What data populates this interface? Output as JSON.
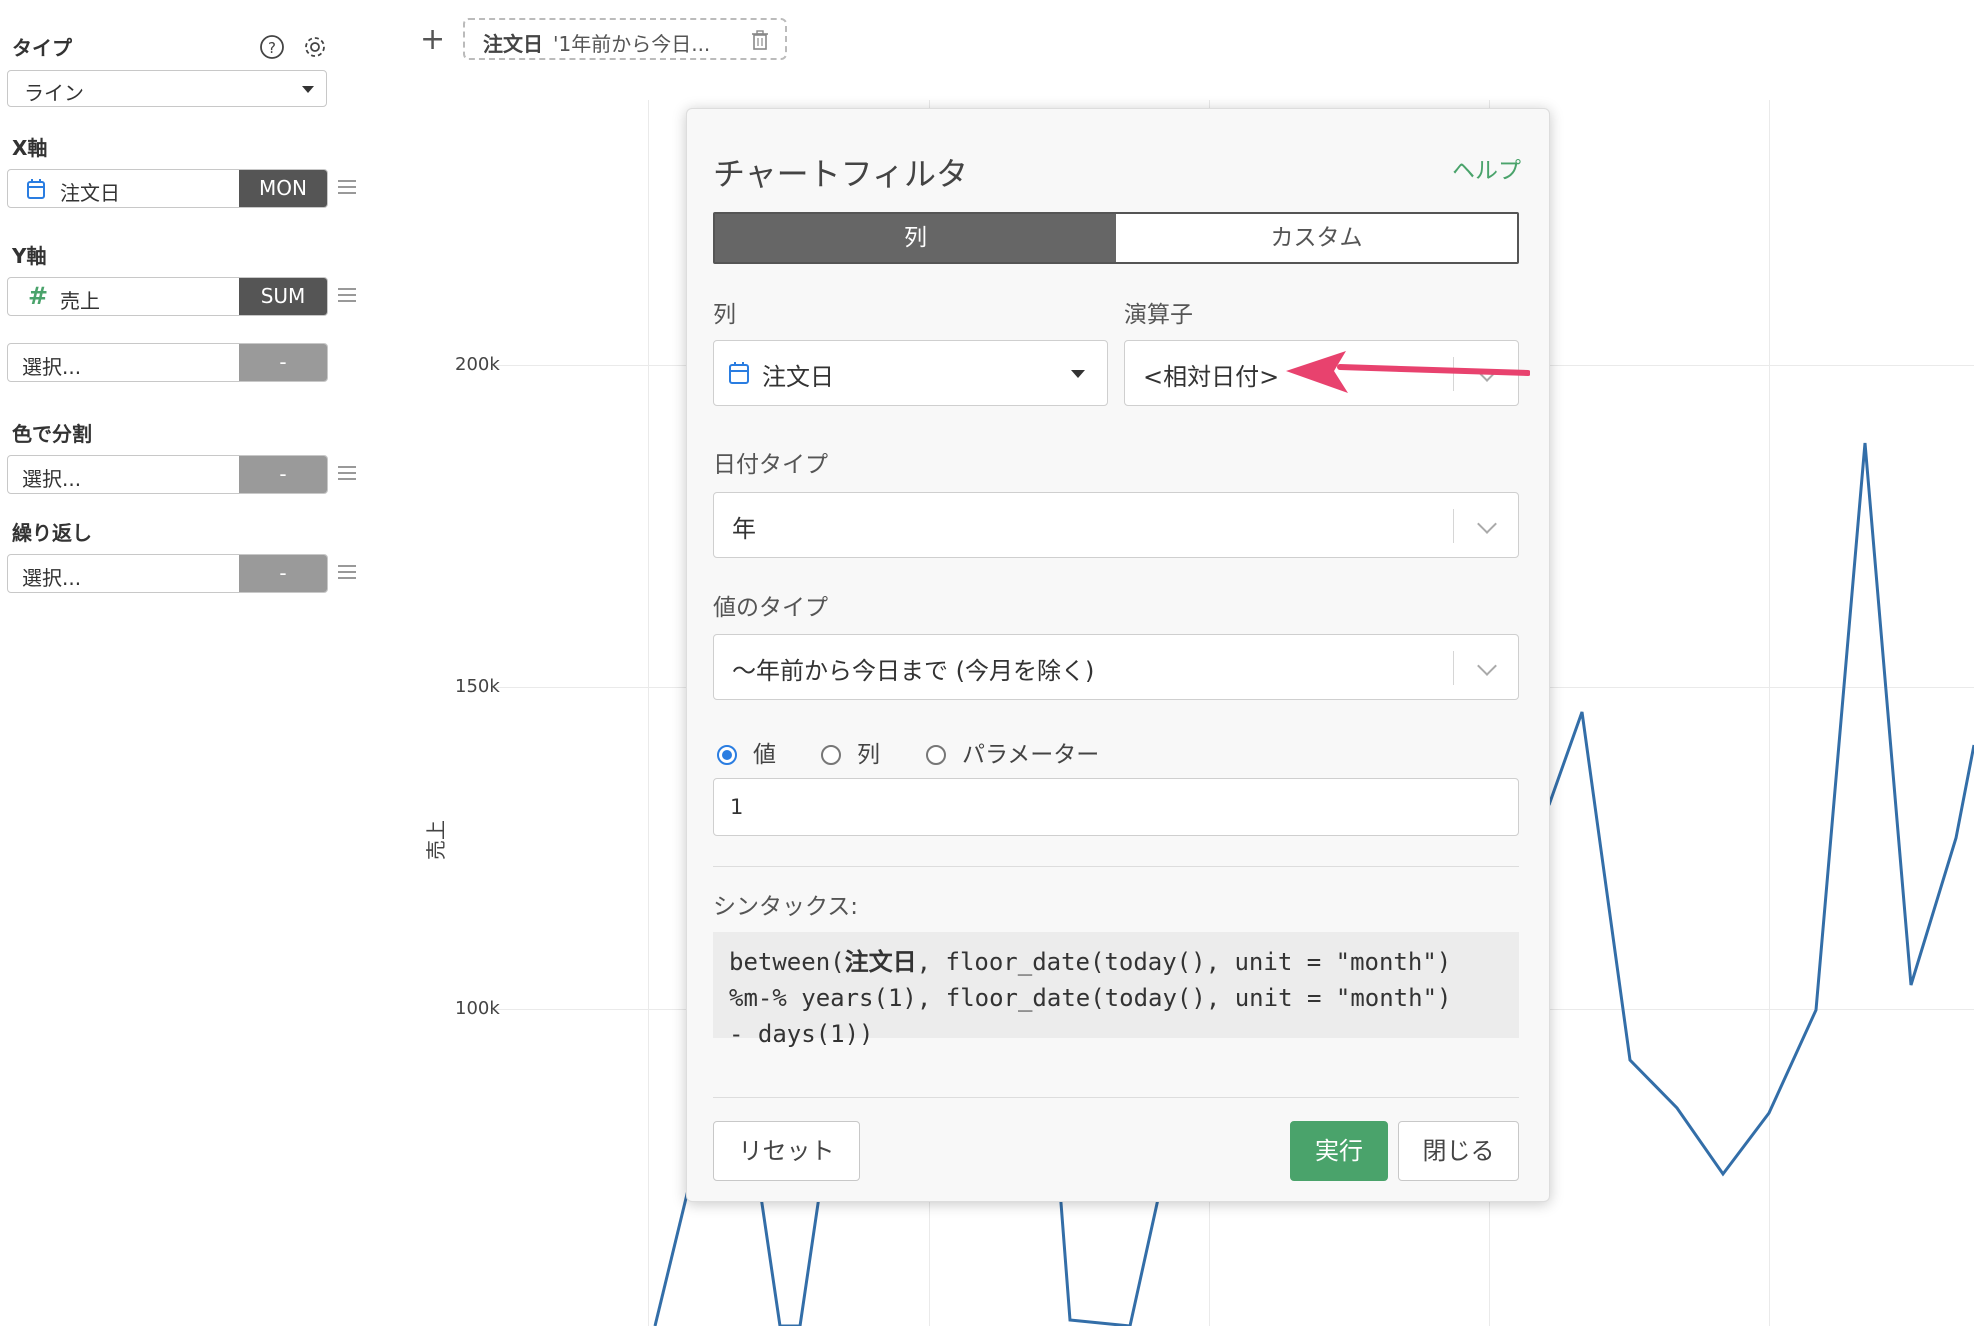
{
  "left_panel": {
    "type_label": "タイプ",
    "type_value": "ライン",
    "x_axis_label": "X軸",
    "x_field": {
      "name": "注文日",
      "agg": "MON"
    },
    "y_axis_label": "Y軸",
    "y_field": {
      "name": "売上",
      "agg": "SUM"
    },
    "extra_select": {
      "placeholder": "選択...",
      "agg": "-"
    },
    "color_label": "色で分割",
    "color_select": {
      "placeholder": "選択...",
      "agg": "-"
    },
    "repeat_label": "繰り返し",
    "repeat_select": {
      "placeholder": "選択...",
      "agg": "-"
    }
  },
  "filter_bar": {
    "add": "+",
    "chip_column": "注文日",
    "chip_value": "'1年前から今日..."
  },
  "chart_data": {
    "type": "line",
    "ylabel": "売上",
    "yticks": [
      "200k",
      "150k",
      "100k"
    ],
    "color": "#336ea8",
    "visible_points": [
      {
        "x_px_hint": "hidden by dialog"
      }
    ]
  },
  "dialog": {
    "title": "チャートフィルタ",
    "help": "ヘルプ",
    "tabs": [
      {
        "label": "列",
        "active": true
      },
      {
        "label": "カスタム",
        "active": false
      }
    ],
    "column_label": "列",
    "column_value": "注文日",
    "operator_label": "演算子",
    "operator_value": "<相対日付>",
    "date_type_label": "日付タイプ",
    "date_type_value": "年",
    "value_type_label": "値のタイプ",
    "value_type_value": "〜年前から今日まで (今月を除く)",
    "radios": [
      {
        "label": "値",
        "checked": true
      },
      {
        "label": "列",
        "checked": false
      },
      {
        "label": "パラメーター",
        "checked": false
      }
    ],
    "value_input": "1",
    "syntax_label": "シンタックス:",
    "syntax_prefix": "between(",
    "syntax_col": "注文日",
    "syntax_line1_rest": ", floor_date(today(), unit = \"month\")",
    "syntax_line2": "%m-% years(1), floor_date(today(), unit = \"month\")",
    "syntax_line3": "- days(1))",
    "reset": "リセット",
    "run": "実行",
    "close": "閉じる"
  },
  "colors": {
    "accent_green": "#4aa36b",
    "annotation_arrow": "#e8426e",
    "line": "#336ea8"
  }
}
